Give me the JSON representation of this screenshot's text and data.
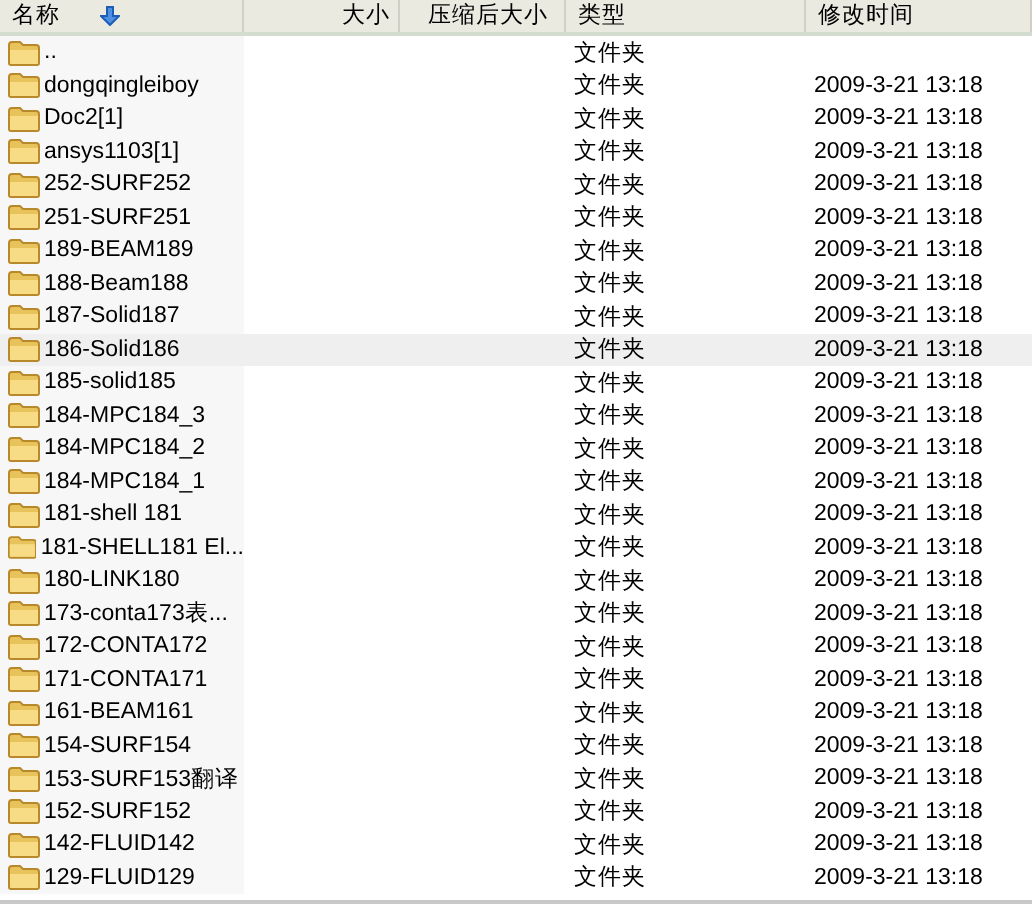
{
  "columns": [
    {
      "label": "名称",
      "sorted": true
    },
    {
      "label": "大小",
      "sorted": false
    },
    {
      "label": "压缩后大小",
      "sorted": false
    },
    {
      "label": "类型",
      "sorted": false
    },
    {
      "label": "修改时间",
      "sorted": false
    }
  ],
  "rows": [
    {
      "name": "..",
      "type": "文件夹",
      "selected": false
    },
    {
      "name": "dongqingleiboy",
      "type": "文件夹",
      "modified": "2009-3-21 13:18",
      "selected": false
    },
    {
      "name": "Doc2[1]",
      "type": "文件夹",
      "modified": "2009-3-21 13:18",
      "selected": false
    },
    {
      "name": "ansys1103[1]",
      "type": "文件夹",
      "modified": "2009-3-21 13:18",
      "selected": false
    },
    {
      "name": "252-SURF252",
      "type": "文件夹",
      "modified": "2009-3-21 13:18",
      "selected": false
    },
    {
      "name": "251-SURF251",
      "type": "文件夹",
      "modified": "2009-3-21 13:18",
      "selected": false
    },
    {
      "name": "189-BEAM189",
      "type": "文件夹",
      "modified": "2009-3-21 13:18",
      "selected": false
    },
    {
      "name": "188-Beam188",
      "type": "文件夹",
      "modified": "2009-3-21 13:18",
      "selected": false
    },
    {
      "name": "187-Solid187",
      "type": "文件夹",
      "modified": "2009-3-21 13:18",
      "selected": false
    },
    {
      "name": "186-Solid186",
      "type": "文件夹",
      "modified": "2009-3-21 13:18",
      "selected": true
    },
    {
      "name": "185-solid185",
      "type": "文件夹",
      "modified": "2009-3-21 13:18",
      "selected": false
    },
    {
      "name": "184-MPC184_3",
      "type": "文件夹",
      "modified": "2009-3-21 13:18",
      "selected": false
    },
    {
      "name": "184-MPC184_2",
      "type": "文件夹",
      "modified": "2009-3-21 13:18",
      "selected": false
    },
    {
      "name": "184-MPC184_1",
      "type": "文件夹",
      "modified": "2009-3-21 13:18",
      "selected": false
    },
    {
      "name": "181-shell 181",
      "type": "文件夹",
      "modified": "2009-3-21 13:18",
      "selected": false
    },
    {
      "name": "181-SHELL181 El...",
      "type": "文件夹",
      "modified": "2009-3-21 13:18",
      "selected": false
    },
    {
      "name": "180-LINK180",
      "type": "文件夹",
      "modified": "2009-3-21 13:18",
      "selected": false
    },
    {
      "name": "173-conta173表...",
      "type": "文件夹",
      "modified": "2009-3-21 13:18",
      "selected": false
    },
    {
      "name": "172-CONTA172",
      "type": "文件夹",
      "modified": "2009-3-21 13:18",
      "selected": false
    },
    {
      "name": "171-CONTA171",
      "type": "文件夹",
      "modified": "2009-3-21 13:18",
      "selected": false
    },
    {
      "name": "161-BEAM161",
      "type": "文件夹",
      "modified": "2009-3-21 13:18",
      "selected": false
    },
    {
      "name": "154-SURF154",
      "type": "文件夹",
      "modified": "2009-3-21 13:18",
      "selected": false
    },
    {
      "name": "153-SURF153翻译",
      "type": "文件夹",
      "modified": "2009-3-21 13:18",
      "selected": false
    },
    {
      "name": "152-SURF152",
      "type": "文件夹",
      "modified": "2009-3-21 13:18",
      "selected": false
    },
    {
      "name": "142-FLUID142",
      "type": "文件夹",
      "modified": "2009-3-21 13:18",
      "selected": false
    },
    {
      "name": "129-FLUID129",
      "type": "文件夹",
      "modified": "2009-3-21 13:18",
      "selected": false
    }
  ]
}
